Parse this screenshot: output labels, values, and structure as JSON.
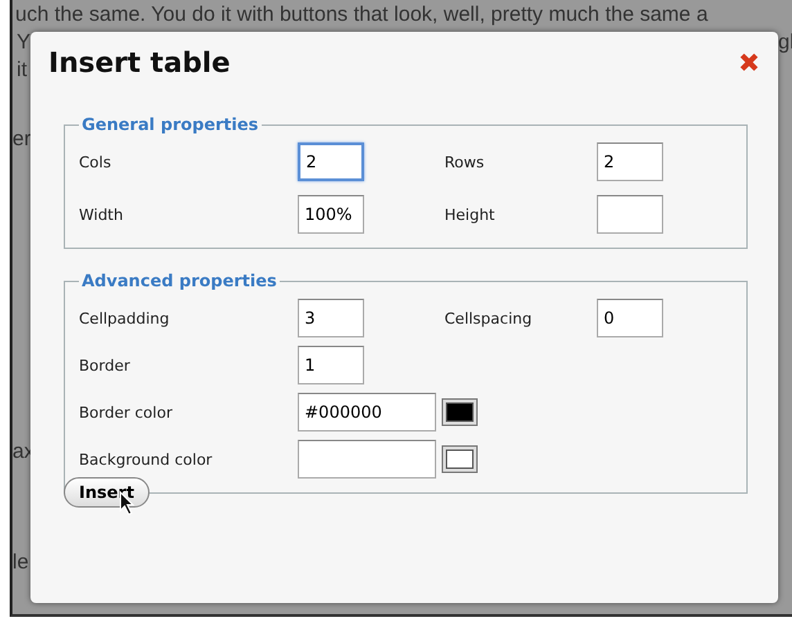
{
  "background": {
    "lines": [
      "uch the same. You do it with buttons that look, well, pretty much the same a",
      "Y",
      "it",
      "er",
      "ax",
      "le",
      "gl"
    ]
  },
  "dialog": {
    "title": "Insert table",
    "sections": [
      {
        "legend": "General properties",
        "rows": [
          [
            {
              "label": "Cols",
              "value": "2",
              "kind": "text",
              "focused": true
            },
            {
              "label": "Rows",
              "value": "2",
              "kind": "text",
              "focused": false
            }
          ],
          [
            {
              "label": "Width",
              "value": "100%",
              "kind": "text",
              "focused": false
            },
            {
              "label": "Height",
              "kind": "text",
              "focused": false
            }
          ]
        ]
      },
      {
        "legend": "Advanced properties",
        "rows": [
          [
            {
              "label": "Cellpadding",
              "value": "3",
              "kind": "text",
              "focused": false
            },
            {
              "label": "Cellspacing",
              "value": "0",
              "kind": "text",
              "focused": false
            }
          ],
          [
            {
              "label": "Border",
              "value": "1",
              "kind": "text",
              "focused": false
            }
          ],
          [
            {
              "label": "Border color",
              "value": "#000000",
              "kind": "color",
              "color": "#000000",
              "focused": false
            }
          ],
          [
            {
              "label": "Background color",
              "kind": "color",
              "color": "#ffffff",
              "focused": false
            }
          ]
        ]
      }
    ],
    "button": "Insert"
  }
}
